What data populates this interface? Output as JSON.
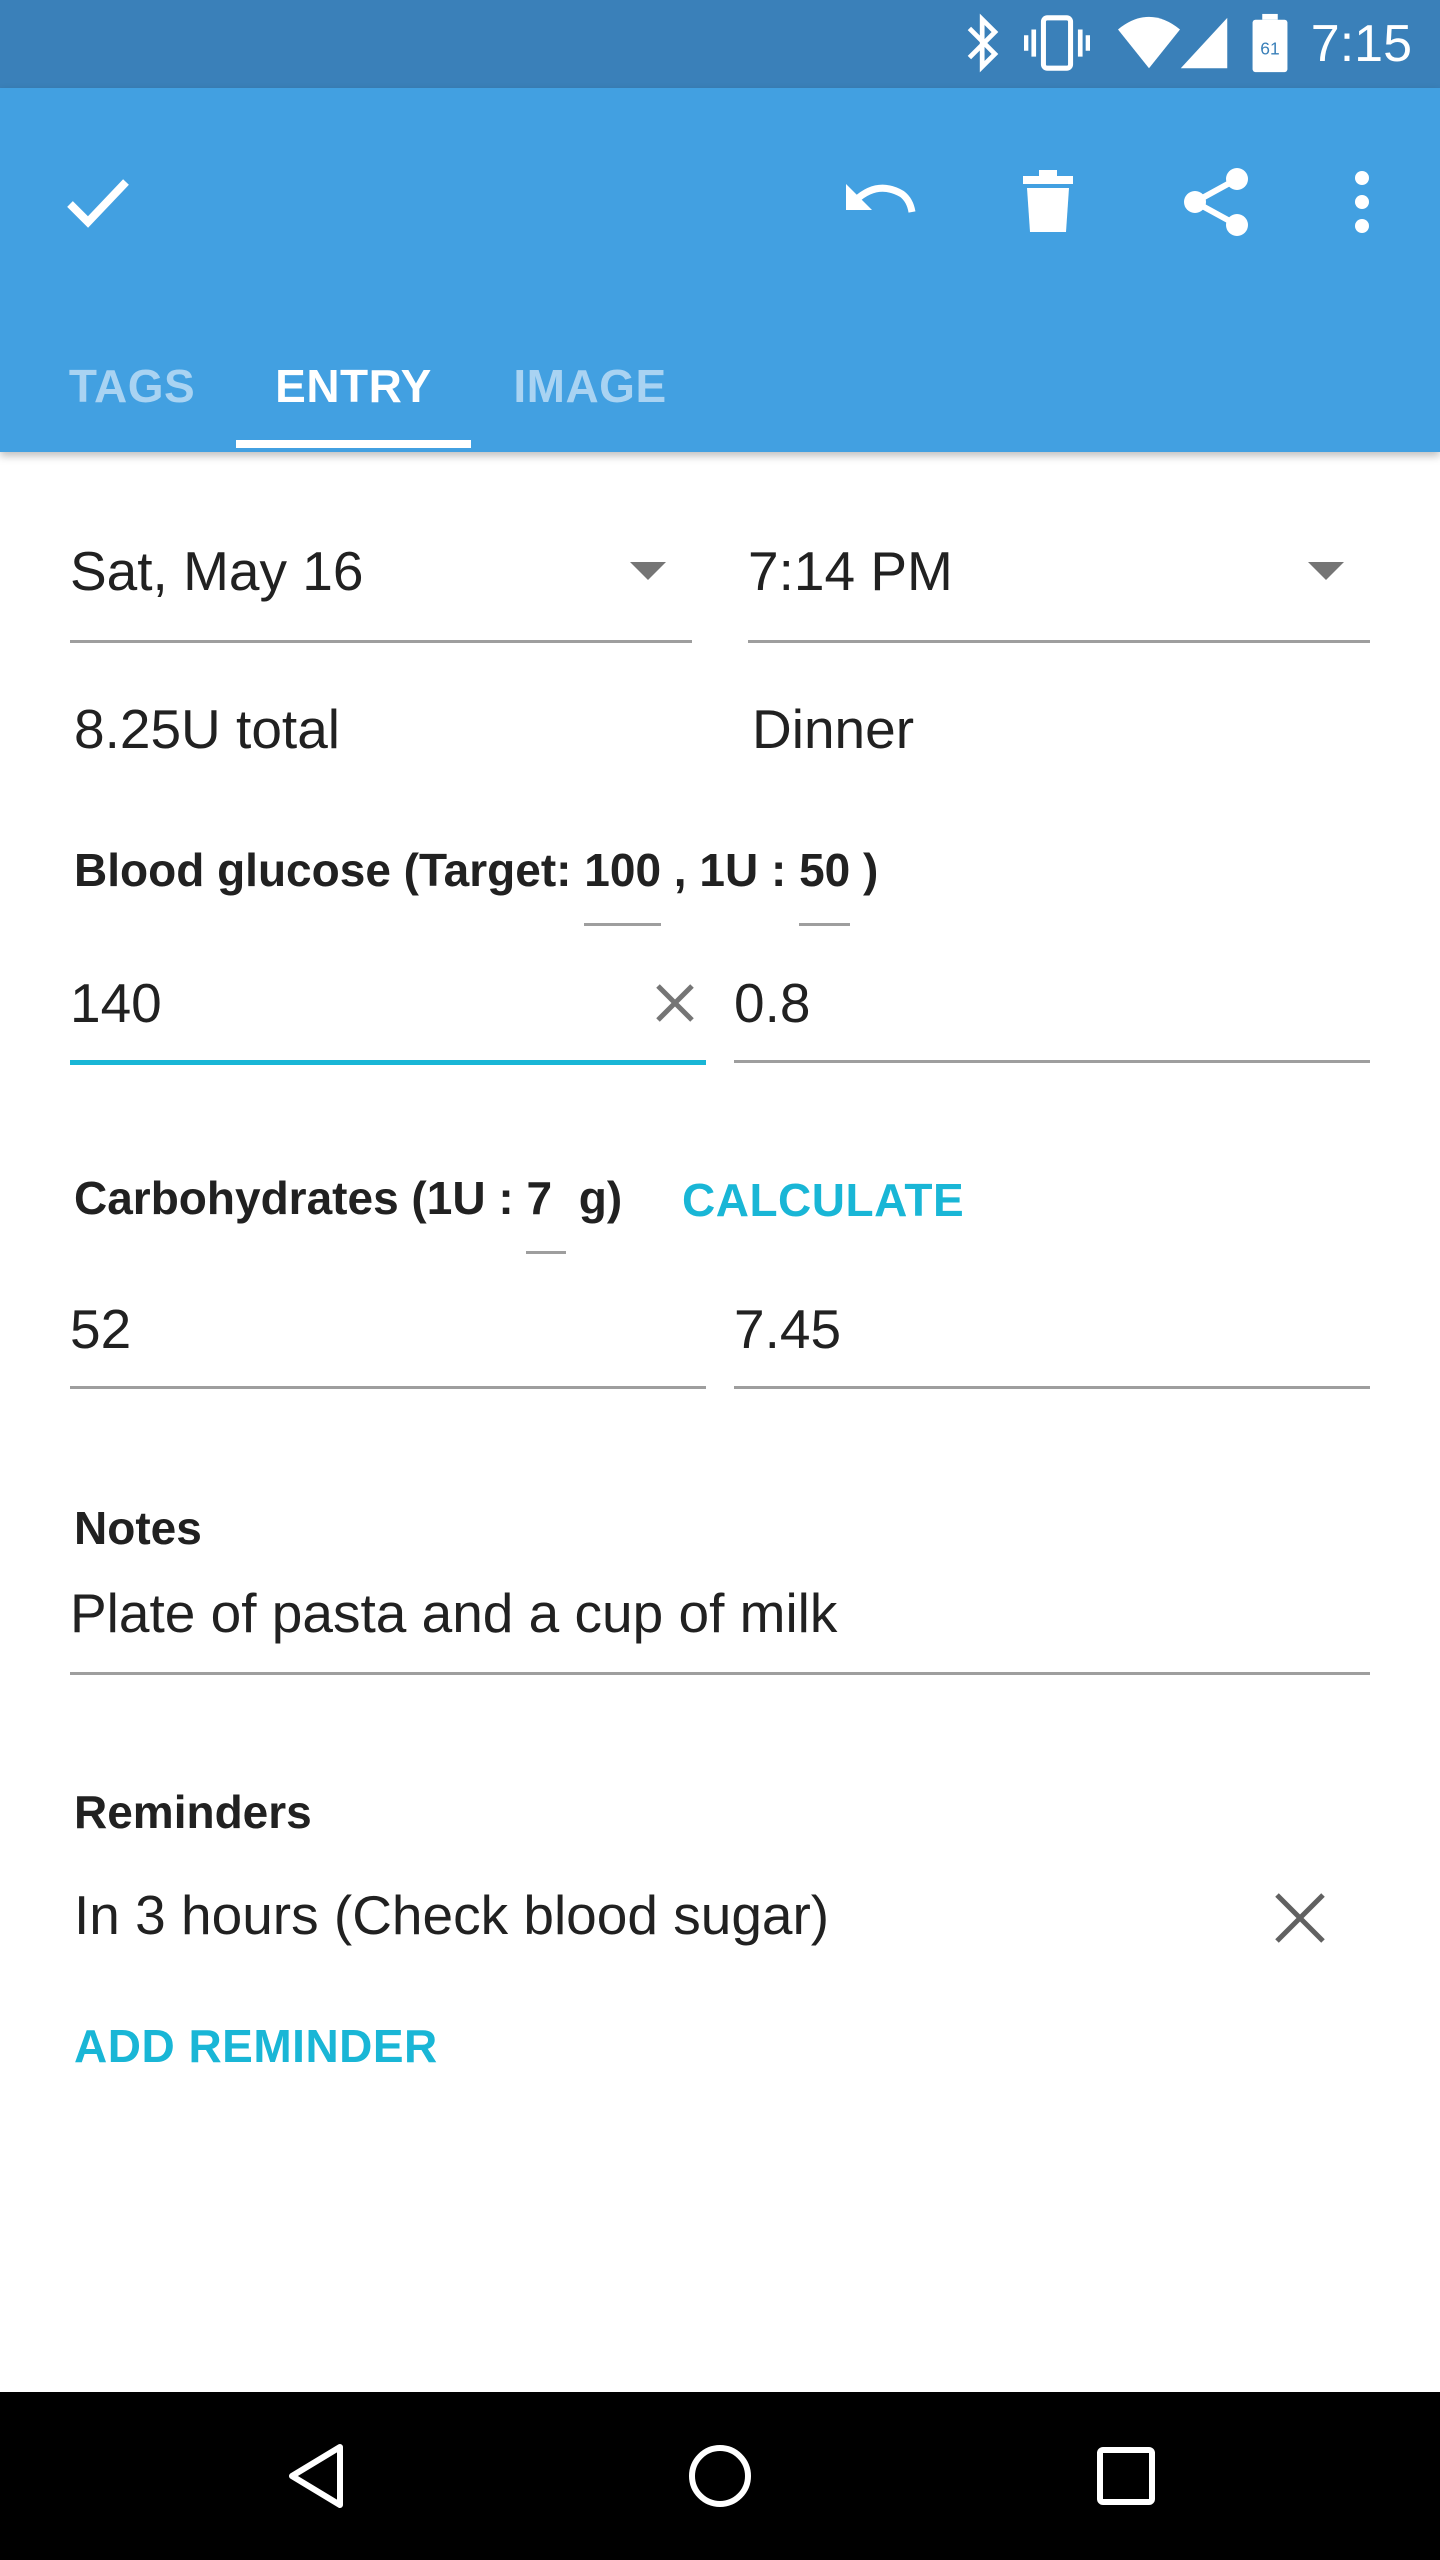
{
  "status_bar": {
    "time": "7:15",
    "battery_level": "61",
    "icons": [
      "bluetooth-icon",
      "vibrate-icon",
      "wifi-icon",
      "cell-signal-icon",
      "battery-icon"
    ]
  },
  "toolbar": {
    "actions": [
      "check-icon",
      "undo-icon",
      "delete-icon",
      "share-icon",
      "more-vert-icon"
    ]
  },
  "tabs": [
    {
      "label": "TAGS",
      "active": false
    },
    {
      "label": "ENTRY",
      "active": true
    },
    {
      "label": "IMAGE",
      "active": false
    }
  ],
  "entry": {
    "date": "Sat, May 16",
    "time": "7:14 PM",
    "total": "8.25U total",
    "meal": "Dinner",
    "glucose": {
      "label_prefix": "Blood glucose (Target: ",
      "target": "100",
      "label_mid": " , 1U : ",
      "ratio": "50",
      "label_suffix": " )",
      "value": "140",
      "units": "0.8"
    },
    "carbs": {
      "label_prefix": "Carbohydrates (1U : ",
      "ratio": "7",
      "label_suffix": " g)",
      "calculate_label": "CALCULATE",
      "value": "52",
      "units": "7.45"
    },
    "notes": {
      "label": "Notes",
      "value": "Plate of pasta and a cup of milk"
    },
    "reminders": {
      "label": "Reminders",
      "items": [
        {
          "text": "In 3 hours (Check blood sugar)"
        }
      ],
      "add_label": "ADD REMINDER"
    }
  },
  "colors": {
    "status_bar": "#3a80b9",
    "app_bar": "#42a0e1",
    "accent": "#19b6d6",
    "nav_bar": "#000000"
  }
}
